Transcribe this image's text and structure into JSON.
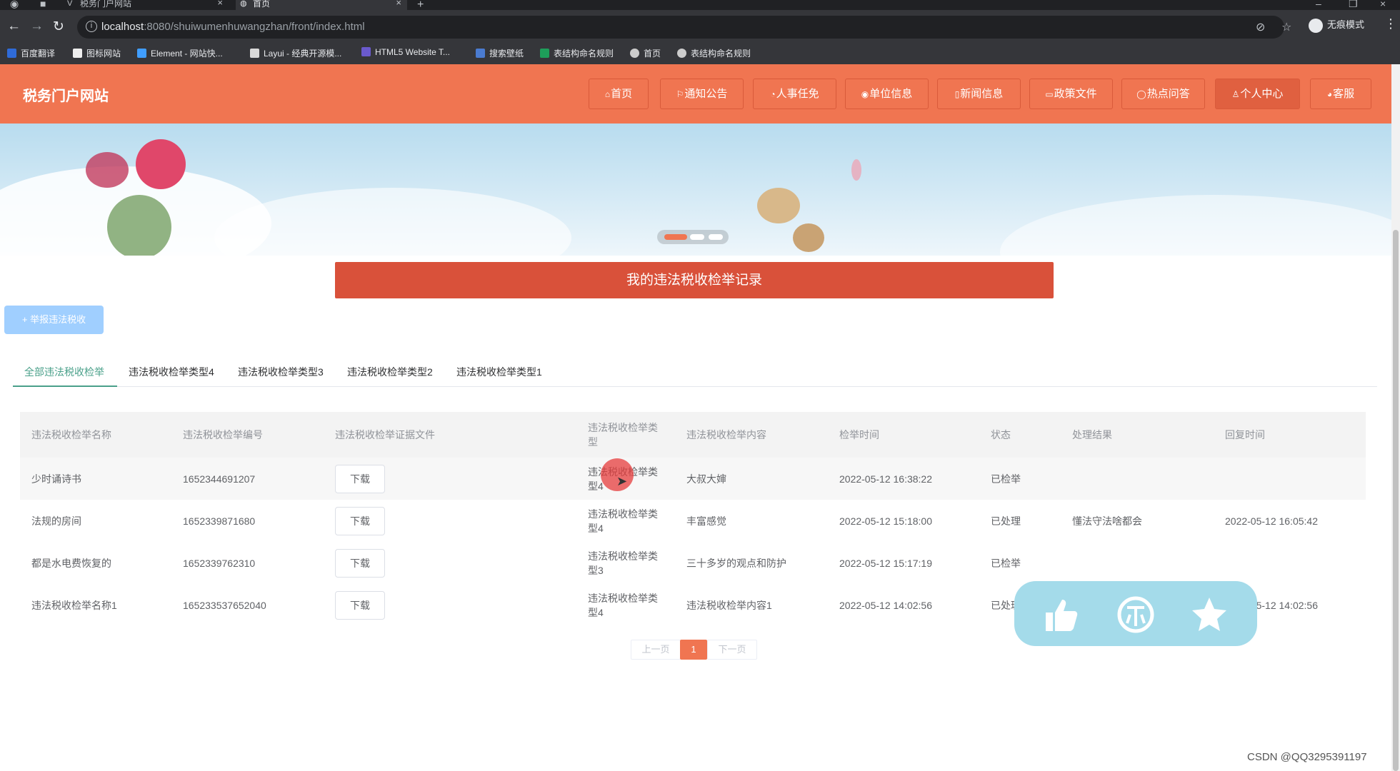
{
  "browser": {
    "tabs": [
      {
        "label": "税务门户网站"
      },
      {
        "label": "首页"
      }
    ],
    "url_host": "localhost",
    "url_path": ":8080/shuiwumenhuwangzhan/front/index.html",
    "incognito_label": "无痕模式",
    "bookmarks": [
      {
        "label": "百度翻译",
        "color": "#2f6bd8"
      },
      {
        "label": "图标网站",
        "color": "#333333"
      },
      {
        "label": "Element - 网站快...",
        "color": "#409eff"
      },
      {
        "label": "Layui - 经典开源模...",
        "color": "#ffffff"
      },
      {
        "label": "HTML5 Website T...",
        "color": "#6a5acd"
      },
      {
        "label": "搜索壁纸",
        "color": "#4a7bd0"
      },
      {
        "label": "表结构命名规则",
        "color": "#1e9e5a"
      },
      {
        "label": "首页",
        "color": "#cccccc"
      },
      {
        "label": "表结构命名规则",
        "color": "#cccccc"
      }
    ]
  },
  "site": {
    "title": "税务门户网站",
    "nav": [
      {
        "label": "首页",
        "icon": "home-icon"
      },
      {
        "label": "通知公告",
        "icon": "flag-icon"
      },
      {
        "label": "人事任免",
        "icon": "user-icon"
      },
      {
        "label": "单位信息",
        "icon": "globe-icon"
      },
      {
        "label": "新闻信息",
        "icon": "doc-icon"
      },
      {
        "label": "政策文件",
        "icon": "file-icon"
      },
      {
        "label": "热点问答",
        "icon": "question-icon"
      },
      {
        "label": "个人中心",
        "icon": "person-icon"
      },
      {
        "label": "客服",
        "icon": "service-icon"
      }
    ],
    "accent_color": "#f07551"
  },
  "main": {
    "section_title": "我的违法税收检举记录",
    "add_button": "+ 举报违法税收",
    "tabs": [
      {
        "label": "全部违法税收检举"
      },
      {
        "label": "违法税收检举类型4"
      },
      {
        "label": "违法税收检举类型3"
      },
      {
        "label": "违法税收检举类型2"
      },
      {
        "label": "违法税收检举类型1"
      }
    ],
    "table": {
      "headers": [
        "违法税收检举名称",
        "违法税收检举编号",
        "违法税收检举证据文件",
        "违法税收检举类型",
        "违法税收检举内容",
        "检举时间",
        "状态",
        "处理结果",
        "回复时间"
      ],
      "download_label": "下载",
      "rows": [
        {
          "name": "少时诵诗书",
          "number": "1652344691207",
          "type": "违法税收检举类型4",
          "content": "大叔大婶",
          "time": "2022-05-12 16:38:22",
          "status": "已检举",
          "result": "",
          "reply_time": ""
        },
        {
          "name": "法规的房间",
          "number": "1652339871680",
          "type": "违法税收检举类型4",
          "content": "丰富感觉",
          "time": "2022-05-12 15:18:00",
          "status": "已处理",
          "result": "懂法守法啥都会",
          "reply_time": "2022-05-12 16:05:42"
        },
        {
          "name": "都是水电费恢复的",
          "number": "1652339762310",
          "type": "违法税收检举类型3",
          "content": "三十多岁的观点和防护",
          "time": "2022-05-12 15:17:19",
          "status": "已检举",
          "result": "",
          "reply_time": ""
        },
        {
          "name": "违法税收检举名称1",
          "number": "165233537652040",
          "type": "违法税收检举类型4",
          "content": "违法税收检举内容1",
          "time": "2022-05-12 14:02:56",
          "status": "已处理",
          "result": "",
          "reply_time": "2022-05-12 14:02:56"
        }
      ]
    },
    "pagination": {
      "prev": "上一页",
      "current": "1",
      "next": "下一页"
    }
  },
  "widget": {
    "icons": [
      "thumbs-up-icon",
      "coin-icon",
      "star-icon"
    ]
  },
  "watermark": "CSDN @QQ3295391197"
}
